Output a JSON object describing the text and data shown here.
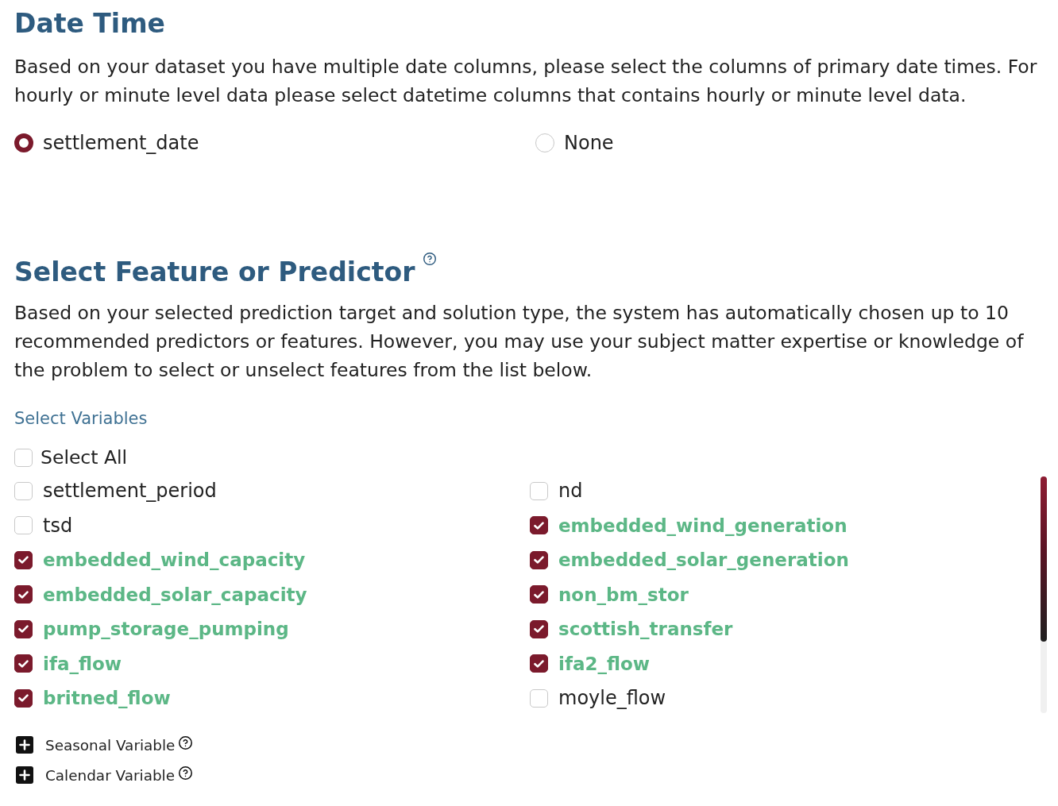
{
  "date_time": {
    "title": "Date Time",
    "description": "Based on your dataset you have multiple date columns, please select the columns of primary date times. For hourly or minute level data please select datetime columns that contains hourly or minute level data.",
    "options": [
      {
        "label": "settlement_date",
        "selected": true
      },
      {
        "label": "None",
        "selected": false
      }
    ]
  },
  "feature_selection": {
    "title": "Select Feature or Predictor",
    "description": "Based on your selected prediction target and solution type, the system has automatically chosen up to 10 recommended predictors or features. However, you may use your subject matter expertise or knowledge of the problem to select or unselect features from the list below.",
    "variables_label": "Select Variables",
    "select_all": {
      "label": "Select All",
      "checked": false
    },
    "variables": [
      {
        "label": "settlement_period",
        "checked": false
      },
      {
        "label": "nd",
        "checked": false
      },
      {
        "label": "tsd",
        "checked": false
      },
      {
        "label": "embedded_wind_generation",
        "checked": true
      },
      {
        "label": "embedded_wind_capacity",
        "checked": true
      },
      {
        "label": "embedded_solar_generation",
        "checked": true
      },
      {
        "label": "embedded_solar_capacity",
        "checked": true
      },
      {
        "label": "non_bm_stor",
        "checked": true
      },
      {
        "label": "pump_storage_pumping",
        "checked": true
      },
      {
        "label": "scottish_transfer",
        "checked": true
      },
      {
        "label": "ifa_flow",
        "checked": true
      },
      {
        "label": "ifa2_flow",
        "checked": true
      },
      {
        "label": "britned_flow",
        "checked": true
      },
      {
        "label": "moyle_flow",
        "checked": false
      }
    ]
  },
  "sections": [
    {
      "label": "Seasonal Variable",
      "expanded": false
    },
    {
      "label": "Calendar Variable",
      "expanded": false
    }
  ]
}
